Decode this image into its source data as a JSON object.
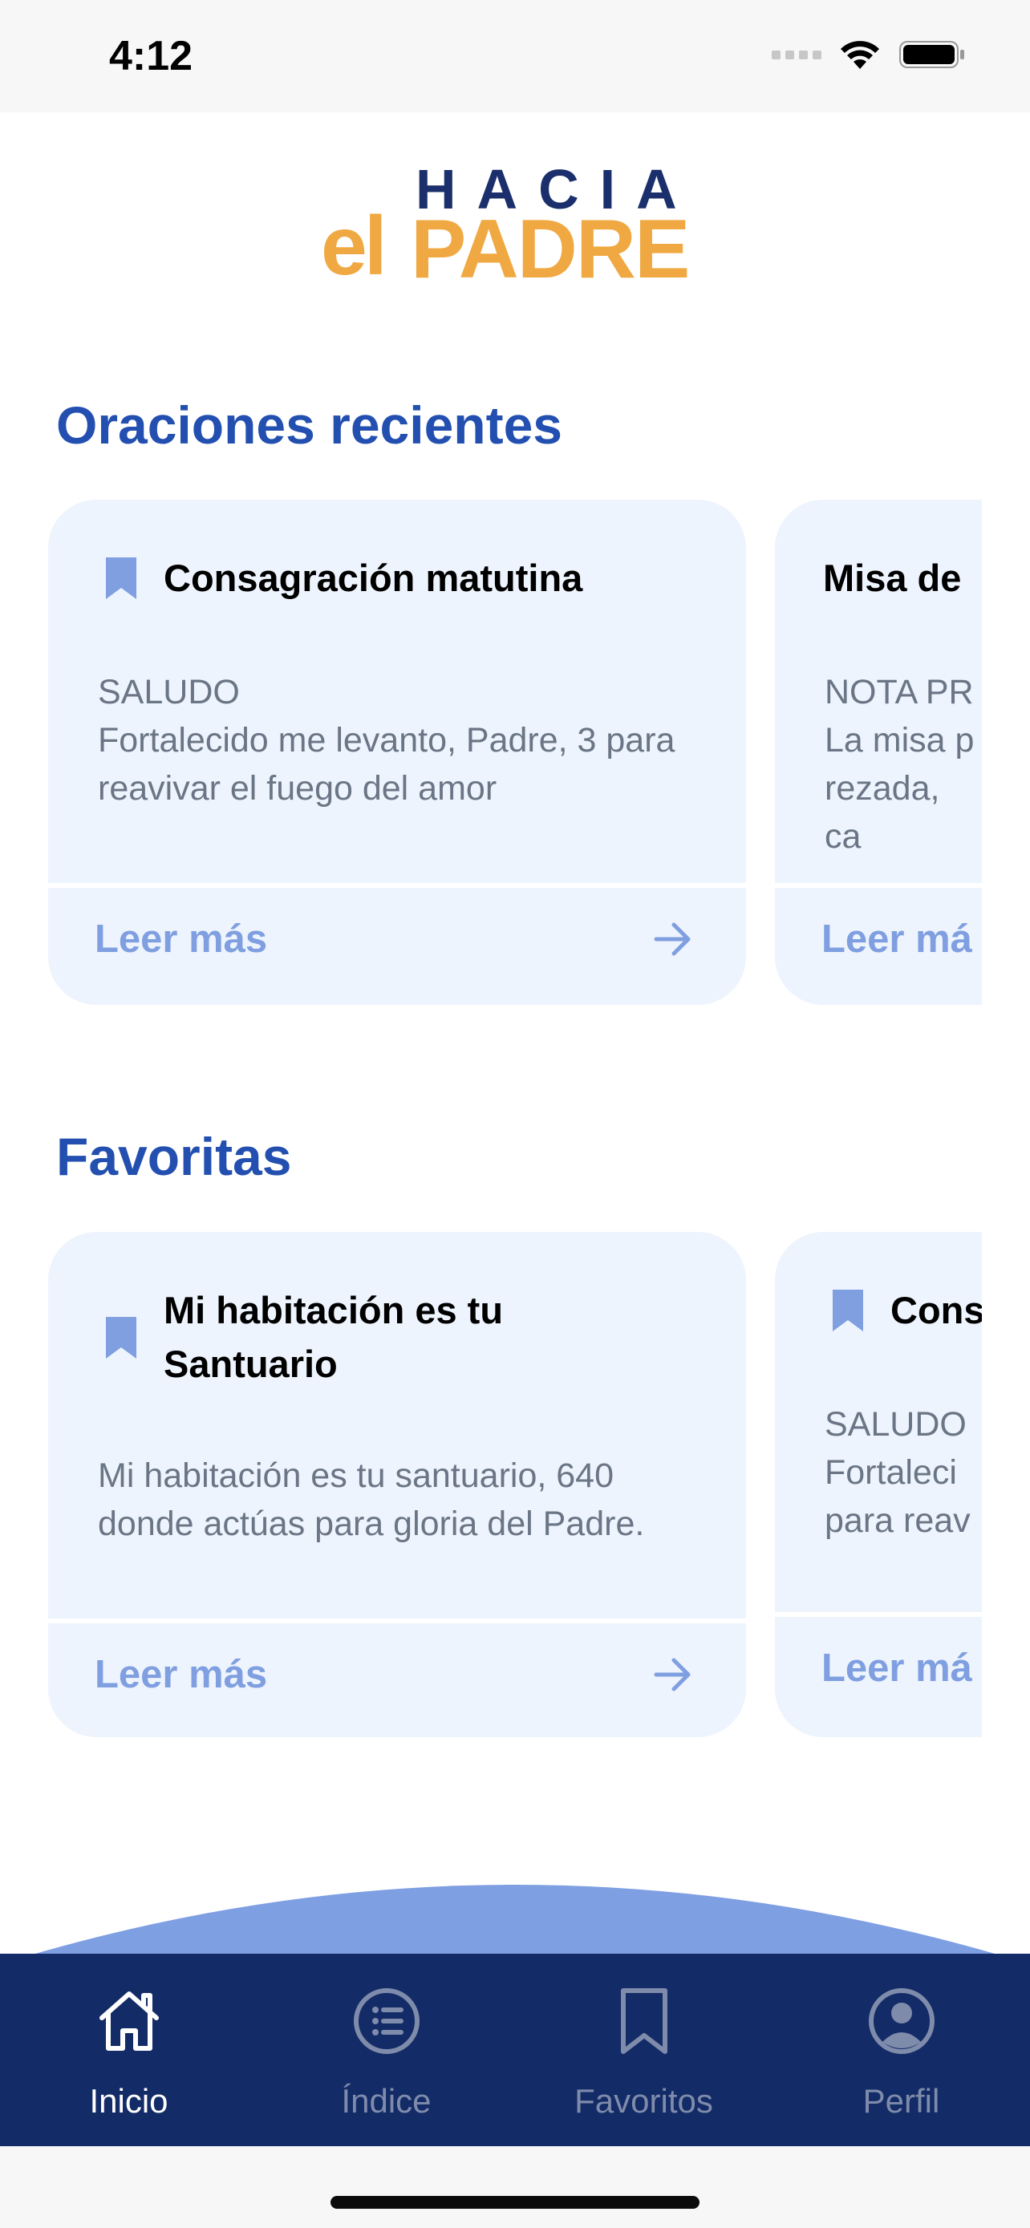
{
  "status": {
    "time": "4:12"
  },
  "logo": {
    "top": "HACIA",
    "el": "el",
    "padre": "PADRE"
  },
  "sections": {
    "recent": {
      "title": "Oraciones recientes",
      "cards": [
        {
          "title": "Consagración matutina",
          "label": "SALUDO",
          "text": "Fortalecido me levanto, Padre, 3 para reavivar el fuego del amor",
          "cta": "Leer más",
          "bookmarked": true
        },
        {
          "title": "Misa de",
          "label": "NOTA PR",
          "text": "La misa p rezada, ca",
          "cta": "Leer má",
          "bookmarked": false
        }
      ]
    },
    "favorites": {
      "title": "Favoritas",
      "cards": [
        {
          "title": "Mi habitación es tu Santuario",
          "label": "",
          "text": "Mi habitación es tu santuario, 640 donde actúas para gloria del Padre.",
          "cta": "Leer más",
          "bookmarked": true
        },
        {
          "title": "Cons",
          "label": "SALUDO",
          "text": "Fortaleci para reav",
          "cta": "Leer má",
          "bookmarked": true
        }
      ]
    }
  },
  "tabs": [
    {
      "label": "Inicio",
      "icon": "home-icon",
      "active": true
    },
    {
      "label": "Índice",
      "icon": "list-icon",
      "active": false
    },
    {
      "label": "Favoritos",
      "icon": "bookmark-icon",
      "active": false
    },
    {
      "label": "Perfil",
      "icon": "profile-icon",
      "active": false
    }
  ],
  "colors": {
    "accent_blue": "#2350b0",
    "logo_orange": "#f0a942",
    "logo_navy": "#1a2f6b",
    "card_bg": "#eef4fd",
    "link": "#7f9fe0",
    "tabbar": "#132b66"
  }
}
